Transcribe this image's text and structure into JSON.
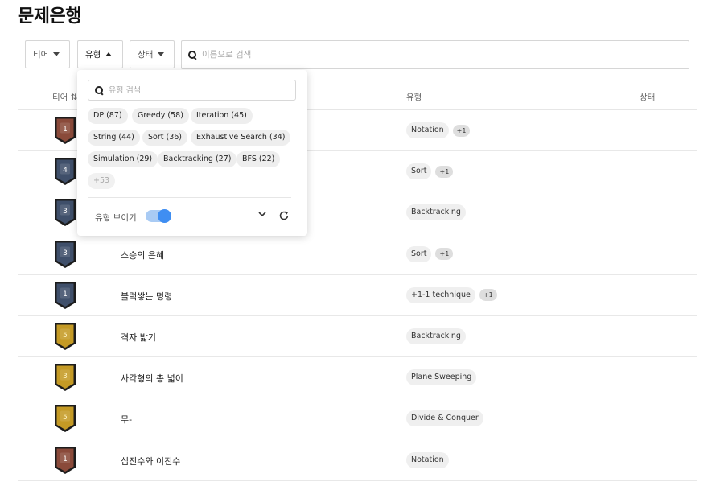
{
  "page": {
    "title": "문제은행"
  },
  "filters": {
    "tier_label": "티어",
    "type_label": "유형",
    "status_label": "상태",
    "search_placeholder": "이름으로 검색"
  },
  "table": {
    "headers": {
      "tier": "티어 ⇅",
      "type": "유형",
      "status": "상태"
    },
    "rows": [
      {
        "tier": "1",
        "tier_color": "bronze",
        "title": "",
        "types": [
          "Notation"
        ],
        "more": "+1"
      },
      {
        "tier": "4",
        "tier_color": "silver",
        "title": "",
        "types": [
          "Sort"
        ],
        "more": "+1"
      },
      {
        "tier": "3",
        "tier_color": "silver",
        "title": "",
        "types": [
          "Backtracking"
        ],
        "more": ""
      },
      {
        "tier": "3",
        "tier_color": "silver",
        "title": "스승의 은혜",
        "types": [
          "Sort"
        ],
        "more": "+1"
      },
      {
        "tier": "1",
        "tier_color": "silver",
        "title": "블럭쌓는 명령",
        "types": [
          "+1-1 technique"
        ],
        "more": "+1"
      },
      {
        "tier": "5",
        "tier_color": "gold",
        "title": "격자 밟기",
        "types": [
          "Backtracking"
        ],
        "more": ""
      },
      {
        "tier": "3",
        "tier_color": "gold",
        "title": "사각형의 총 넓이",
        "types": [
          "Plane Sweeping"
        ],
        "more": ""
      },
      {
        "tier": "5",
        "tier_color": "gold",
        "title": "무-",
        "types": [
          "Divide & Conquer"
        ],
        "more": ""
      },
      {
        "tier": "1",
        "tier_color": "bronze",
        "title": "십진수와 이진수",
        "types": [
          "Notation"
        ],
        "more": ""
      }
    ]
  },
  "type_popup": {
    "search_placeholder": "유형 검색",
    "chips": [
      "DP (87)",
      "Greedy (58)",
      "Iteration (45)",
      "String (44)",
      "Sort (36)",
      "Exhaustive Search (34)",
      "Simulation (29)",
      "Backtracking (27)",
      "BFS (22)",
      "+53"
    ],
    "toggle_label": "유형 보이기",
    "toggle_on": true
  },
  "colors": {
    "bronze": "#8a4a3a",
    "silver": "#3f4f6a",
    "gold": "#c49a25",
    "toggle_accent": "#3f8ef2"
  }
}
